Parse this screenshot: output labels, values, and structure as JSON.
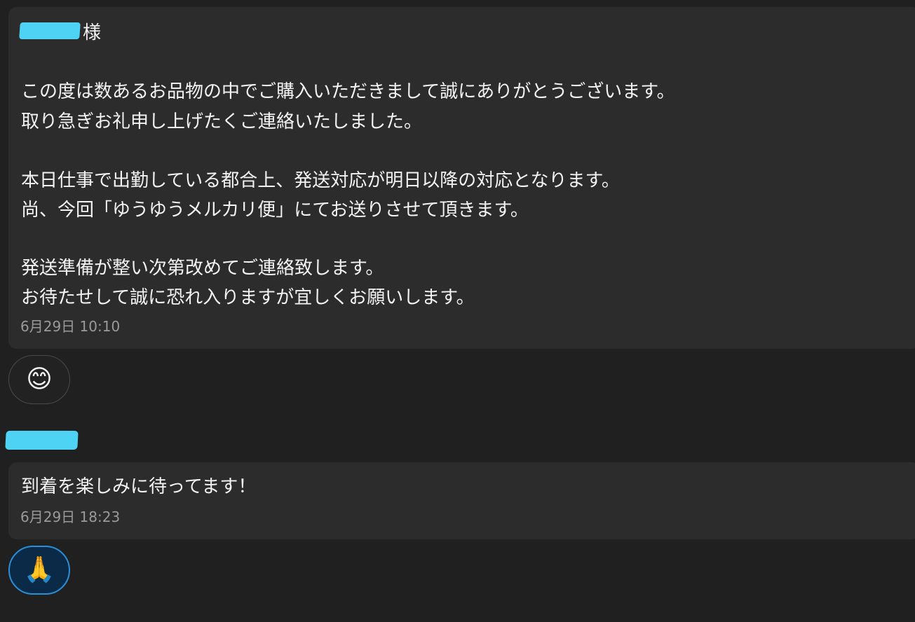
{
  "messages": [
    {
      "salutation_suffix": "様",
      "lines": [
        "この度は数あるお品物の中でご購入いただきまして誠にありがとうございます。",
        "取り急ぎお礼申し上げたくご連絡いたしました。",
        "本日仕事で出勤している都合上、発送対応が明日以降の対応となります。",
        "尚、今回「ゆうゆうメルカリ便」にてお送りさせて頂きます。",
        "発送準備が整い次第改めてご連絡致します。",
        "お待たせして誠に恐れ入りますが宜しくお願いします。"
      ],
      "timestamp": "6月29日 10:10",
      "reaction": "😊"
    },
    {
      "lines": [
        "到着を楽しみに待ってます！"
      ],
      "timestamp": "6月29日 18:23",
      "reaction": "🙏"
    }
  ],
  "colors": {
    "background": "#202020",
    "bubble": "#2c2c2c",
    "redaction": "#4fd3f5",
    "timestamp": "#9a9a9a",
    "reaction_selected_border": "#2a8fd8"
  },
  "icons": {
    "reaction_1": "smiling-face-icon",
    "reaction_2": "folded-hands-icon"
  }
}
